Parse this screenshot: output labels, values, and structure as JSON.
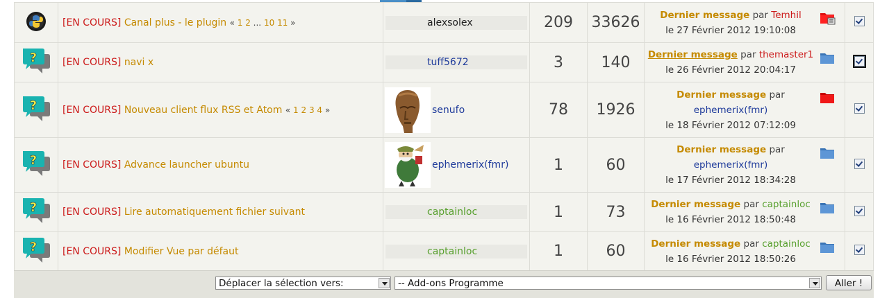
{
  "rows": [
    {
      "status": "[EN COURS]",
      "title": "Canal plus - le plugin",
      "pages": {
        "open": "«",
        "p1": "1",
        "p2": "2",
        "dots": "...",
        "p3": "10",
        "p4": "11",
        "close": "»"
      },
      "author": "alexsolex",
      "replies": "209",
      "views": "33626",
      "last_title": "Dernier message",
      "last_par": "par",
      "last_by": "Temhil",
      "last_date": "le 27 Février 2012 19:10:08"
    },
    {
      "status": "[EN COURS]",
      "title": "navi x",
      "author": "tuff5672",
      "replies": "3",
      "views": "140",
      "last_title": "Dernier message",
      "last_par": "par",
      "last_by": "themaster1",
      "last_date": "le 26 Février 2012 20:04:17"
    },
    {
      "status": "[EN COURS]",
      "title": "Nouveau client flux RSS et Atom",
      "pages": {
        "open": "«",
        "p1": "1",
        "p2": "2",
        "p3": "3",
        "p4": "4",
        "close": "»"
      },
      "author": "senufo",
      "replies": "78",
      "views": "1926",
      "last_title": "Dernier message",
      "last_par": "par",
      "last_by": "ephemerix(fmr)",
      "last_date": "le 18 Février 2012 07:12:09"
    },
    {
      "status": "[EN COURS]",
      "title": "Advance launcher ubuntu",
      "author": "ephemerix(fmr)",
      "replies": "1",
      "views": "60",
      "last_title": "Dernier message",
      "last_par": "par",
      "last_by": "ephemerix(fmr)",
      "last_date": "le 17 Février 2012 18:34:28"
    },
    {
      "status": "[EN COURS]",
      "title": "Lire automatiquement fichier suivant",
      "author": "captainloc",
      "replies": "1",
      "views": "73",
      "last_title": "Dernier message",
      "last_par": "par",
      "last_by": "captainloc",
      "last_date": "le 16 Février 2012 18:50:48"
    },
    {
      "status": "[EN COURS]",
      "title": "Modifier Vue par défaut",
      "author": "captainloc",
      "replies": "1",
      "views": "60",
      "last_title": "Dernier message",
      "last_par": "par",
      "last_by": "captainloc",
      "last_date": "le 16 Février 2012 18:50:26"
    }
  ],
  "footer": {
    "move_select": "Déplacer la sélection vers:",
    "forum_select": "-- Add-ons Programme",
    "go_button": "Aller !"
  },
  "colors": {
    "status": "#cc1a1a",
    "title_link": "#c58a00",
    "folder_blue": "#4a86c8",
    "folder_red": "#e01010"
  }
}
